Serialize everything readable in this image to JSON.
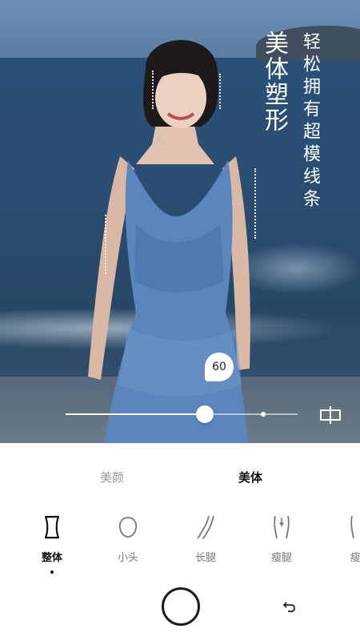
{
  "banner": {
    "headline": "美体塑形",
    "subline": "轻松拥有超模线条"
  },
  "slider": {
    "value": "60",
    "fraction": 0.6,
    "default_fraction": 0.85
  },
  "compare": {
    "icon": "compare-icon"
  },
  "tabs": [
    {
      "label": "美颜",
      "active": false
    },
    {
      "label": "美体",
      "active": true
    }
  ],
  "tools": [
    {
      "label": "整体",
      "icon": "body-outline-icon",
      "selected": true
    },
    {
      "label": "小头",
      "icon": "head-outline-icon",
      "selected": false
    },
    {
      "label": "长腿",
      "icon": "long-leg-icon",
      "selected": false
    },
    {
      "label": "瘦腿",
      "icon": "slim-leg-icon",
      "selected": false
    },
    {
      "label": "瘦",
      "icon": "slim-waist-icon",
      "selected": false
    }
  ],
  "actions": {
    "shutter_icon": "shutter-circle-icon",
    "undo_icon": "undo-arrow-icon"
  },
  "colors": {
    "accent": "#111111",
    "inactive": "#9a9a9a",
    "slider": "#ffffff"
  }
}
